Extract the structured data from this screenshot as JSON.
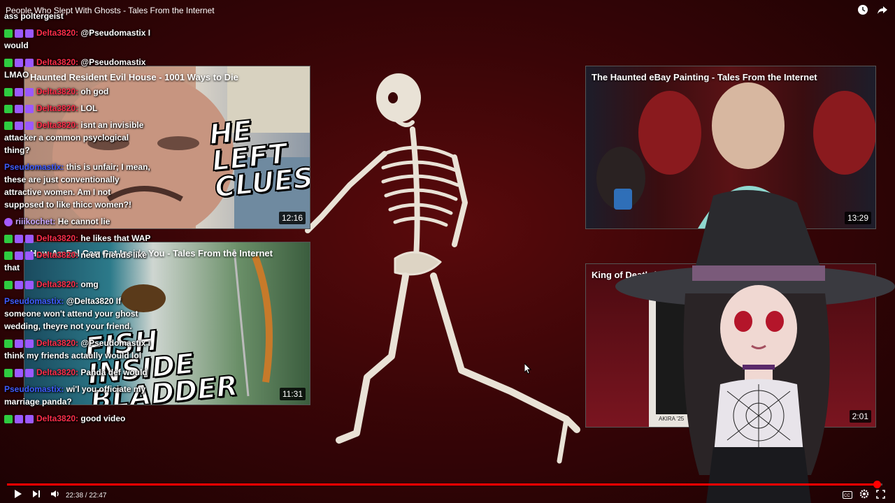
{
  "video_title": "People Who Slept With Ghosts - Tales From the Internet",
  "cards": [
    {
      "title": "Haunted Resident Evil House - 1001 Ways to Die",
      "duration": "12:16",
      "overlay_text": "HE LEFT CLUES"
    },
    {
      "title": "How An Eel Can Get Inside You - Tales From the Internet",
      "duration": "11:31",
      "overlay_text": "FISH INSIDE BLADDER"
    },
    {
      "title": "The Haunted eBay Painting - Tales From the Internet",
      "duration": "13:29",
      "overlay_text": ""
    },
    {
      "title": "King of Death (Akira E",
      "duration": "2:01",
      "overlay_text": "AKIRA '25"
    }
  ],
  "chat": [
    {
      "user": "",
      "text": "ass poltergeist",
      "user_color": "red",
      "badges": []
    },
    {
      "user": "Delta3820:",
      "text": "@Pseudomastix I would",
      "user_color": "red",
      "badges": [
        "check",
        "sub",
        "bits"
      ]
    },
    {
      "user": "Delta3820:",
      "text": "@Pseudomastix LMAO",
      "user_color": "red",
      "badges": [
        "check",
        "sub",
        "bits"
      ]
    },
    {
      "user": "Delta3820:",
      "text": "oh god",
      "user_color": "red",
      "badges": [
        "check",
        "sub",
        "bits"
      ]
    },
    {
      "user": "Delta3820:",
      "text": "LOL",
      "user_color": "red",
      "badges": [
        "check",
        "sub",
        "bits"
      ]
    },
    {
      "user": "Delta3820:",
      "text": "isnt an invisible attacker a common psyclogical thing?",
      "user_color": "red",
      "badges": [
        "check",
        "sub",
        "bits"
      ]
    },
    {
      "user": "Pseudomastix:",
      "text": "this is unfair; I mean, these are just conventionally attractive women. Am I not supposed to like thicc women?!",
      "user_color": "blue",
      "badges": []
    },
    {
      "user": "riiikochet:",
      "text": "He cannot lie",
      "user_color": "purple",
      "badges": [
        "star"
      ]
    },
    {
      "user": "Delta3820:",
      "text": "he likes that WAP",
      "user_color": "red",
      "badges": [
        "check",
        "sub",
        "bits"
      ]
    },
    {
      "user": "Delta3820:",
      "text": "need friends like that",
      "user_color": "red",
      "badges": [
        "check",
        "sub",
        "bits"
      ]
    },
    {
      "user": "Delta3820:",
      "text": "omg",
      "user_color": "red",
      "badges": [
        "check",
        "sub",
        "bits"
      ]
    },
    {
      "user": "Pseudomastix:",
      "text": "@Delta3820 If someone won't attend your ghost wedding, theyre not your friend.",
      "user_color": "blue",
      "badges": []
    },
    {
      "user": "Delta3820:",
      "text": "@Pseudomastix i think my friends actaully would lol",
      "user_color": "red",
      "badges": [
        "check",
        "sub",
        "bits"
      ]
    },
    {
      "user": "Delta3820:",
      "text": "Panda def would",
      "user_color": "red",
      "badges": [
        "check",
        "sub",
        "bits"
      ]
    },
    {
      "user": "Pseudomastix:",
      "text": "wi'l you officiate my marriage panda?",
      "user_color": "blue",
      "badges": []
    },
    {
      "user": "Delta3820:",
      "text": "good video",
      "user_color": "red",
      "badges": [
        "check",
        "sub",
        "bits"
      ]
    }
  ],
  "player": {
    "time": "22:38 / 22:47",
    "progress": 0.9934
  },
  "icons": [
    "clock-icon",
    "share-icon",
    "play-icon",
    "next-icon",
    "volume-icon",
    "cc-icon",
    "settings-icon",
    "fullscreen-icon"
  ]
}
